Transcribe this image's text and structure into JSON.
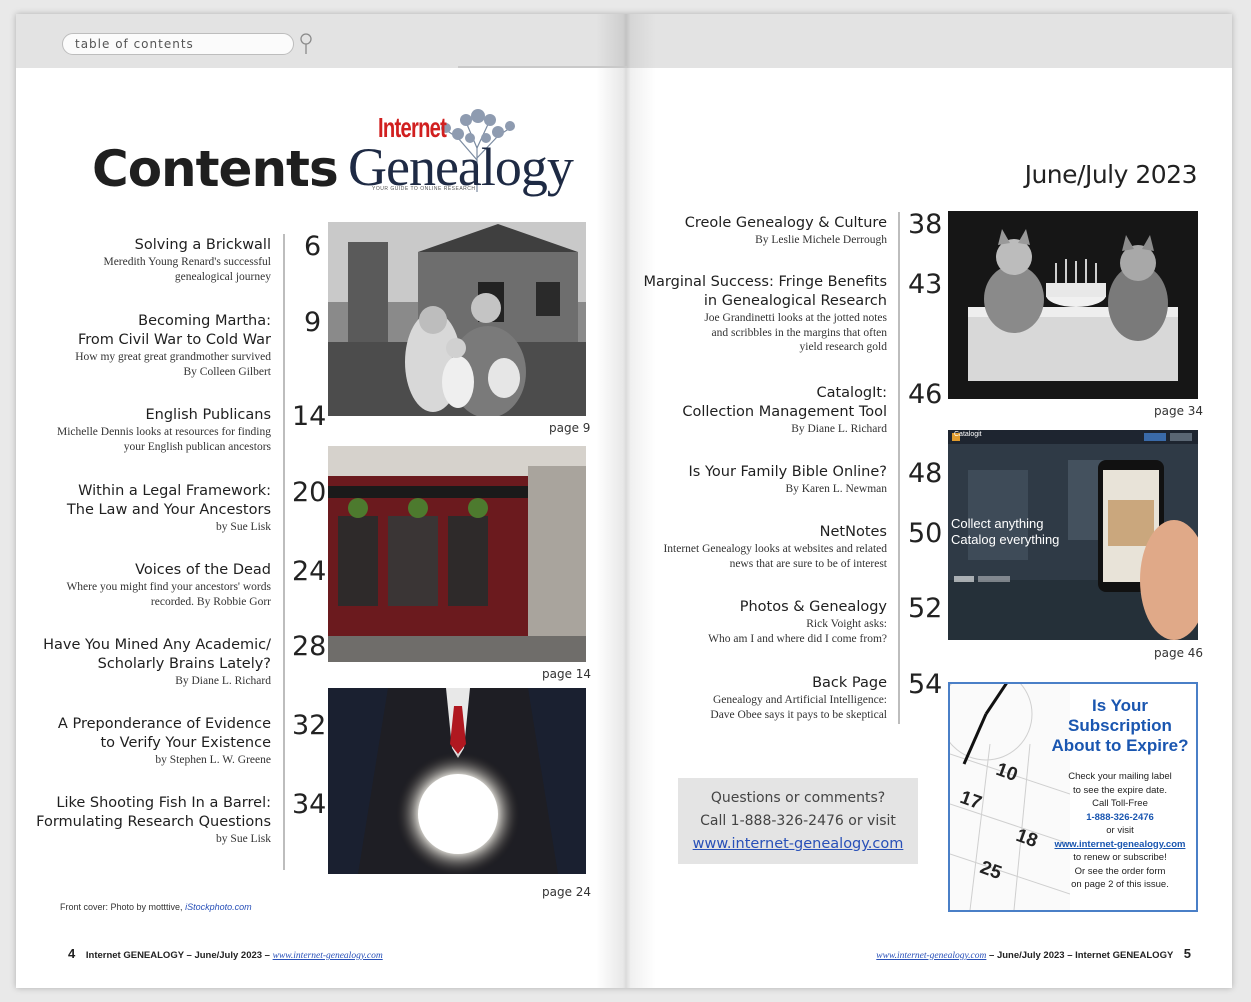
{
  "search": {
    "value": "table of contents"
  },
  "left_page": {
    "heading": "Contents",
    "logo": {
      "word1": "Internet",
      "word2": "Genealogy",
      "tagline": "YOUR GUIDE TO ONLINE RESEARCH"
    },
    "entries": [
      {
        "title_lines": [
          "Solving a Brickwall"
        ],
        "sub_lines": [
          "Meredith Young Renard's successful",
          "genealogical journey"
        ],
        "page": "6"
      },
      {
        "title_lines": [
          "Becoming Martha:",
          "From Civil War to Cold War"
        ],
        "sub_lines": [
          "How my great great grandmother survived",
          "By Colleen Gilbert"
        ],
        "page": "9"
      },
      {
        "title_lines": [
          "English Publicans"
        ],
        "sub_lines": [
          "Michelle Dennis looks at resources for finding",
          "your English publican ancestors"
        ],
        "page": "14"
      },
      {
        "title_lines": [
          "Within a Legal Framework:",
          "The Law and Your Ancestors"
        ],
        "sub_lines": [
          "by Sue Lisk"
        ],
        "page": "20"
      },
      {
        "title_lines": [
          "Voices of the Dead"
        ],
        "sub_lines": [
          "Where you might find your ancestors' words",
          "recorded. By Robbie Gorr"
        ],
        "page": "24"
      },
      {
        "title_lines": [
          "Have You Mined Any Academic/",
          "Scholarly Brains Lately?"
        ],
        "sub_lines": [
          "By Diane L. Richard"
        ],
        "page": "28"
      },
      {
        "title_lines": [
          "A Preponderance of Evidence",
          "to Verify Your Existence"
        ],
        "sub_lines": [
          "by Stephen L. W. Greene"
        ],
        "page": "32"
      },
      {
        "title_lines": [
          "Like Shooting Fish In a Barrel:",
          "Formulating Research Questions"
        ],
        "sub_lines": [
          "by Sue Lisk"
        ],
        "page": "34"
      }
    ],
    "captions": [
      "page 9",
      "page 14",
      "page 24"
    ],
    "credit": {
      "text": "Front cover: Photo by motttive,",
      "source": "iStockphoto.com"
    },
    "footer": {
      "page": "4",
      "text": "Internet GENEALOGY – June/July 2023 –",
      "url": "www.internet-genealogy.com"
    }
  },
  "right_page": {
    "date": "June/July 2023",
    "entries": [
      {
        "title_lines": [
          "Creole Genealogy & Culture"
        ],
        "sub_lines": [
          "By Leslie Michele Derrough"
        ],
        "page": "38"
      },
      {
        "title_lines": [
          "Marginal Success: Fringe Benefits",
          "in Genealogical Research"
        ],
        "sub_lines": [
          "Joe Grandinetti looks at the jotted notes",
          "and scribbles in the margins that often",
          "yield research gold"
        ],
        "page": "43"
      },
      {
        "title_lines": [
          "CatalogIt:",
          "Collection Management Tool"
        ],
        "sub_lines": [
          "By Diane L. Richard"
        ],
        "page": "46"
      },
      {
        "title_lines": [
          "Is Your Family Bible Online?"
        ],
        "sub_lines": [
          "By Karen L. Newman"
        ],
        "page": "48"
      },
      {
        "title_lines": [
          "NetNotes"
        ],
        "sub_lines": [
          "Internet Genealogy looks at websites and related",
          "news that are sure to be of interest"
        ],
        "page": "50"
      },
      {
        "title_lines": [
          "Photos & Genealogy"
        ],
        "sub_lines": [
          "Rick Voight asks:",
          "Who am I and where did I come from?"
        ],
        "page": "52"
      },
      {
        "title_lines": [
          "Back Page"
        ],
        "sub_lines": [
          "Genealogy and Artificial Intelligence:",
          "Dave Obee says it pays to be skeptical"
        ],
        "page": "54"
      }
    ],
    "captions": [
      "page 34",
      "page 46"
    ],
    "screenshot_text": {
      "brand": "Catalogit",
      "line1": "Collect anything",
      "line2": "Catalog everything"
    },
    "questions": {
      "line1": "Questions or comments?",
      "line2": "Call 1-888-326-2476 or visit",
      "link": "www.internet-genealogy.com"
    },
    "ad": {
      "title_lines": [
        "Is Your",
        "Subscription",
        "About to Expire?"
      ],
      "line1": "Check your mailing label",
      "line2": "to see the expire date.",
      "line3": "Call Toll-Free",
      "phone": "1-888-326-2476",
      "line4": "or visit",
      "url": "www.internet-genealogy.com",
      "line5": "to renew or subscribe!",
      "line6": "Or see the order form",
      "line7": "on page 2 of this issue.",
      "calendar_numbers": [
        "17",
        "18",
        "25",
        "10"
      ]
    },
    "footer": {
      "page": "5",
      "url": "www.internet-genealogy.com",
      "text": "– June/July 2023 – Internet GENEALOGY"
    }
  }
}
